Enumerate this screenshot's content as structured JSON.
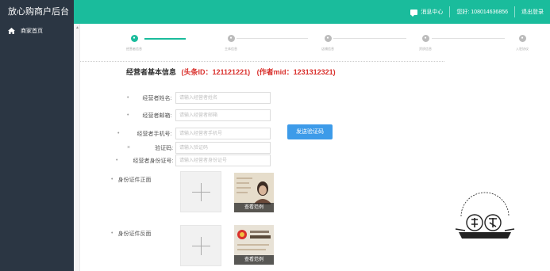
{
  "sidebar": {
    "brand": "放心购商户后台",
    "items": [
      {
        "label": "商家首页",
        "icon": "home-icon"
      }
    ]
  },
  "topbar": {
    "messages_label": "消息中心",
    "account_label": "您好: 108014636856",
    "logout_label": "退出登录"
  },
  "steps": [
    {
      "label": "经营者信息"
    },
    {
      "label": "主体信息"
    },
    {
      "label": "店铺信息"
    },
    {
      "label": "资质信息"
    },
    {
      "label": "入驻协议"
    }
  ],
  "section": {
    "title": "经营者基本信息",
    "headline_id": "(头条ID：121121221)",
    "author_mid": "(作者mid：1231312321)"
  },
  "form": {
    "name_label": "经营者姓名:",
    "name_placeholder": "请输入经营者姓名",
    "email_label": "经营者邮箱:",
    "email_placeholder": "请输入经营者邮箱",
    "phone_label": "经营者手机号:",
    "phone_placeholder": "请输入经营者手机号",
    "code_label": "验证码:",
    "code_placeholder": "请输入验证码",
    "idno_label": "经营者身份证号:",
    "idno_placeholder": "请输入经营者身份证号",
    "send_code_label": "发送验证码",
    "id_front_label": "身份证件正面",
    "id_back_label": "身份证件反面",
    "view_sample_label": "查看范例"
  },
  "colors": {
    "topbar": "#1abc9c",
    "sidebar": "#2b3643",
    "accent_button": "#3d9be9",
    "highlight_red": "#d9302c"
  }
}
